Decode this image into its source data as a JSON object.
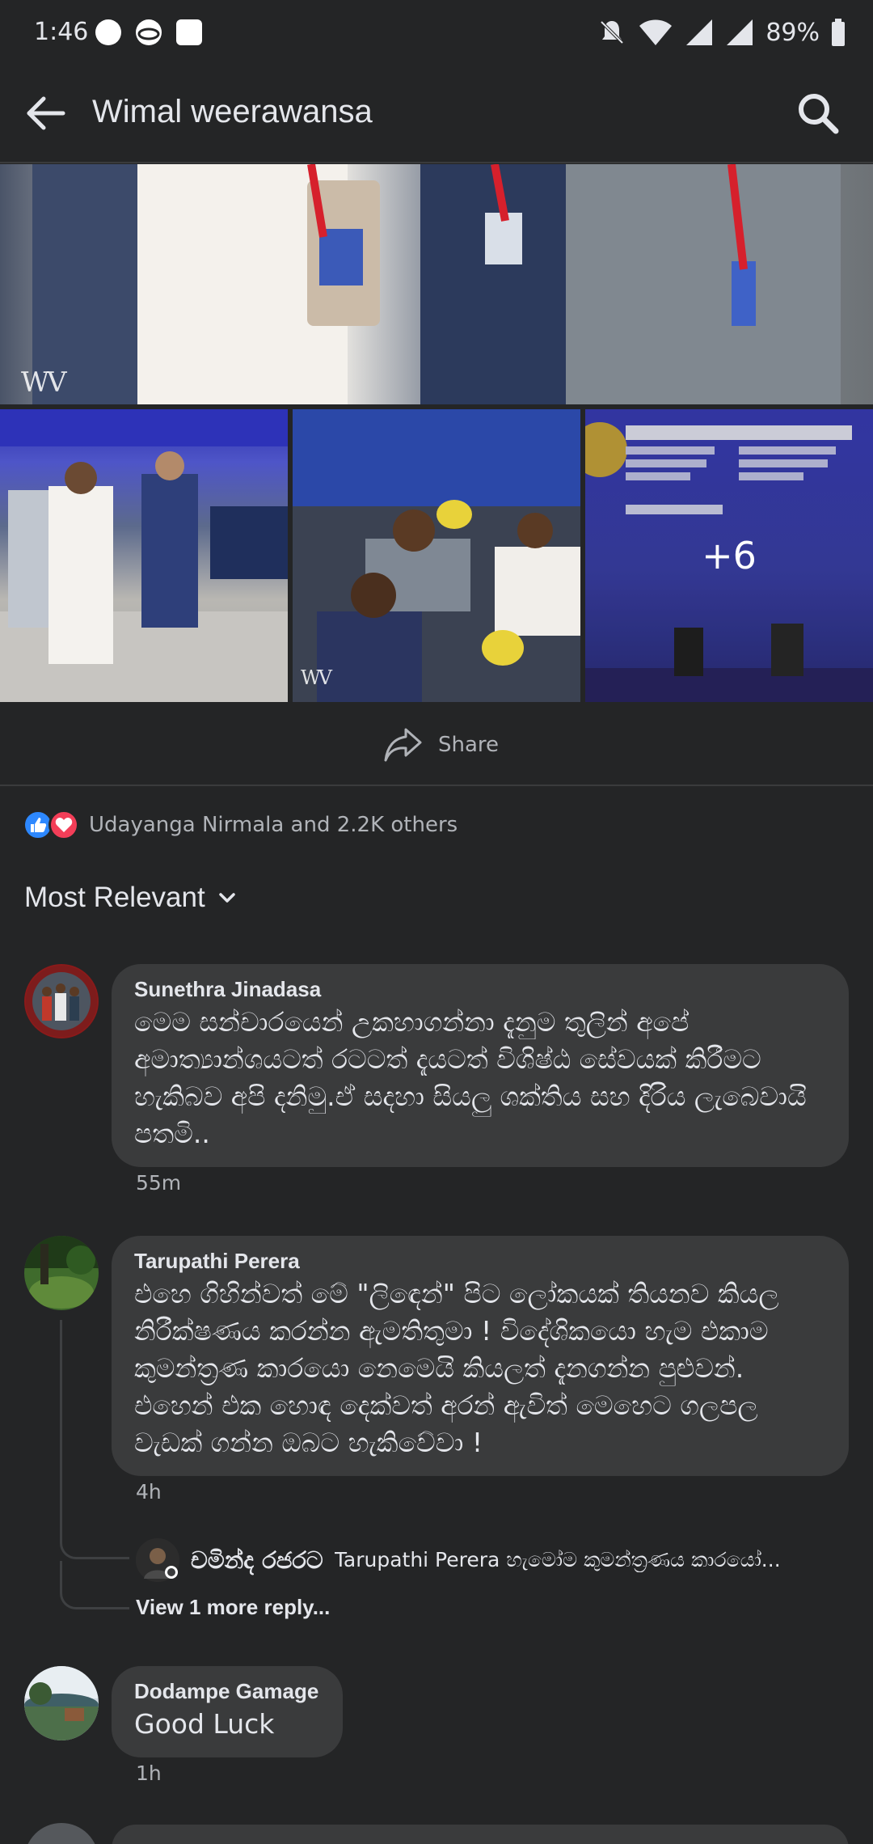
{
  "status_bar": {
    "time": "1:46",
    "battery": "89%",
    "icons": [
      "chat-bubble-icon",
      "vpn-globe-icon",
      "square-app-icon",
      "notifications-muted-icon",
      "wifi-icon",
      "signal-icon",
      "signal-icon",
      "battery-icon"
    ]
  },
  "header": {
    "title": "Wimal weerawansa",
    "back_icon": "arrow-left-icon",
    "search_icon": "search-icon"
  },
  "photos": {
    "watermark": "WV",
    "more_count": "+6"
  },
  "actions": {
    "share_label": "Share"
  },
  "reactions": {
    "summary": "Udayanga Nirmala and 2.2K others",
    "types": [
      "like",
      "love"
    ],
    "colors": {
      "like": "#2d88ff",
      "love": "#f33e58"
    }
  },
  "comments_sort": {
    "label": "Most Relevant"
  },
  "comments": [
    {
      "author": "Sunethra Jinadasa",
      "text": "මෙම සන්චාරයෙන් උකහාගන්නා දැනුම තුලින් අපේ අමාත්‍යාන්ශයටත් රටටත් දැයටත් විශිෂ්ඨ සේවයක් කිරීමට හැකිබව අපි දනිමු.ඒ සදහා සියලු ශක්තිය සහ දිරිය ලැබෙවායි පතමි..",
      "time": "55m"
    },
    {
      "author": "Tarupathi Perera",
      "text": "එහෙ ගිහින්වත් මේ \"ලිඳෙන්\" පිට ලෝකයක් තියනව කියල නිරීක්ෂණය කරන්න ඇමතිතුමා ! විදේශිකයො හැම එකාම කුමන්ත්‍රණ කාරයො නෙමෙයි කියලත් දැනගන්න පුළුවන්. එහෙන් එක හොඳ දෙක්වත් අරන් ඇවිත් මෙහෙට ගලපල වැඩක් ගන්න ඔබට හැකිවේවා !",
      "time": "4h",
      "reply_preview": {
        "author": "චමින්ද රජරට",
        "text": "Tarupathi Perera හැමෝම කුමන්ත්‍රණය කාරයෝ..."
      },
      "view_more": "View 1 more reply..."
    },
    {
      "author": "Dodampe Gamage",
      "text": "Good  Luck",
      "time": "1h"
    }
  ]
}
